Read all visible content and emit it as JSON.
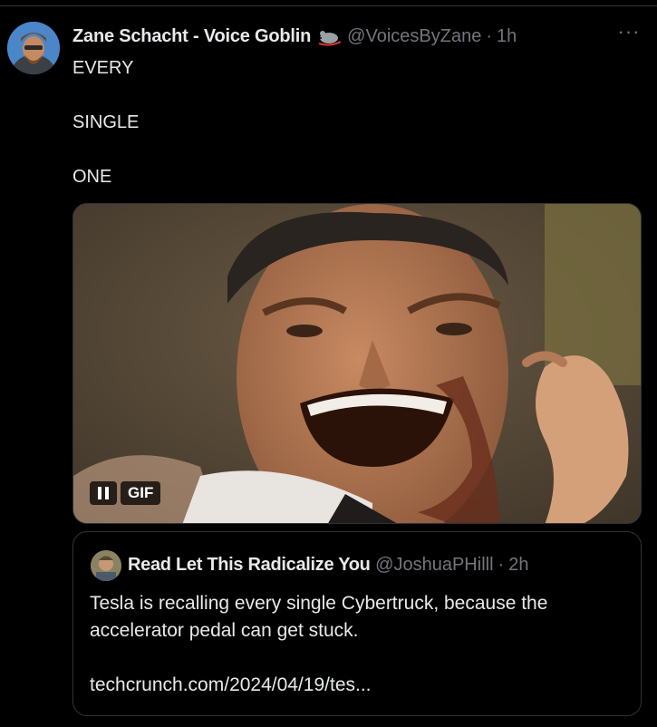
{
  "tweet": {
    "author_name": "Zane Schacht - Voice Goblin",
    "author_handle": "@VoicesByZane",
    "separator": "·",
    "time": "1h",
    "more_label": "···",
    "text_lines": [
      "EVERY",
      "SINGLE",
      "ONE"
    ],
    "media": {
      "type": "gif",
      "pause_icon": "pause-icon",
      "badge_label": "GIF"
    }
  },
  "quoted_tweet": {
    "author_name": "Read Let This Radicalize You",
    "author_handle": "@JoshuaPHilll",
    "separator": "·",
    "time": "2h",
    "text": "Tesla is recalling every single Cybertruck, because the accelerator pedal can get stuck.",
    "link": "techcrunch.com/2024/04/19/tes..."
  },
  "colors": {
    "background": "#000000",
    "text_primary": "#e7e9ea",
    "text_secondary": "#71767b",
    "border": "#2f3336"
  }
}
